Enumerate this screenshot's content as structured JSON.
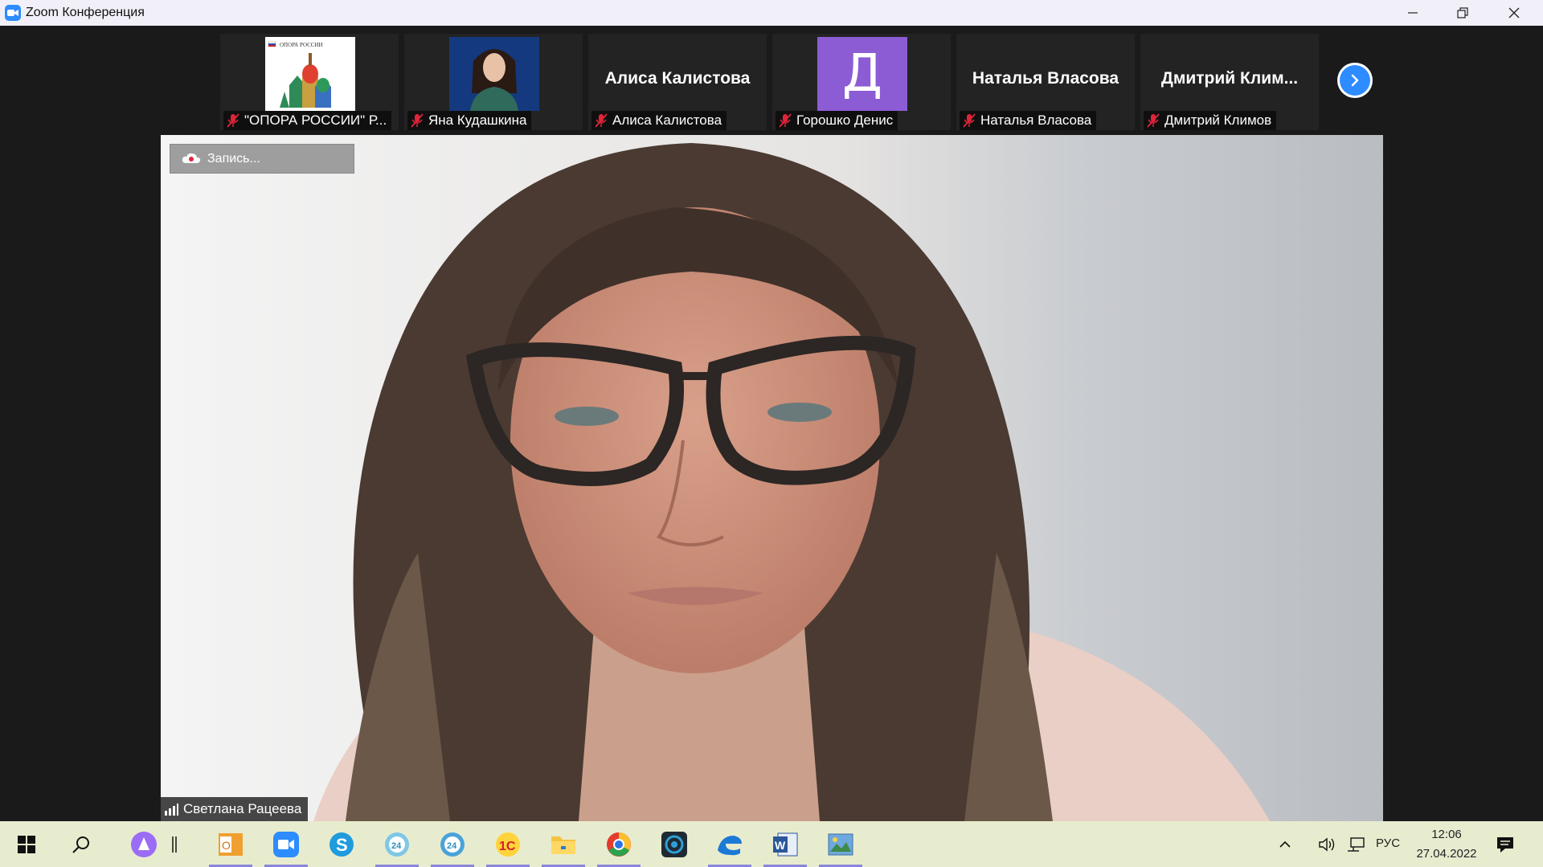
{
  "window": {
    "title": "Zoom Конференция"
  },
  "participants": [
    {
      "label": "\"ОПОРА РОССИИ\" Р...",
      "type": "logo"
    },
    {
      "label": "Яна Кудашкина",
      "type": "photo"
    },
    {
      "label": "Алиса Калистова",
      "type": "name",
      "display_name": "Алиса Калистова"
    },
    {
      "label": "Горошко Денис",
      "type": "avatar",
      "avatar_letter": "Д",
      "avatar_color": "#8c5cd4"
    },
    {
      "label": "Наталья Власова",
      "type": "name",
      "display_name": "Наталья Власова"
    },
    {
      "label": "Дмитрий Климов",
      "type": "name",
      "display_name": "Дмитрий Клим..."
    }
  ],
  "thumb_text": {
    "logo_caption": "ОПОРА РОССИИ"
  },
  "main_video": {
    "recording_label": "Запись...",
    "speaker_name": "Светлана Рацеева"
  },
  "taskbar": {
    "apps": [
      "start-icon",
      "search-icon",
      "alice-icon",
      "outlook-icon",
      "zoom-icon",
      "skype-icon",
      "bitrix24-icon",
      "bitrix24-icon",
      "1c-icon",
      "file-explorer-icon",
      "chrome-icon",
      "camera-icon",
      "edge-icon",
      "word-icon",
      "picture-icon"
    ],
    "language": "РУС",
    "time": "12:06",
    "date": "27.04.2022"
  },
  "colors": {
    "zoom_blue": "#2d8cff",
    "mute_red": "#e0243a",
    "taskbar_bg": "#e8eccf",
    "active_indicator": "#8a85d8"
  }
}
